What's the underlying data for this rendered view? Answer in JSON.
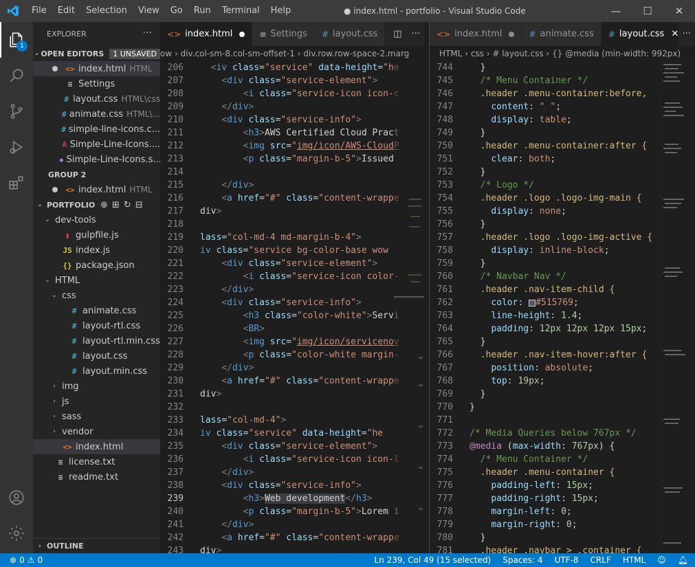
{
  "titlebar": {
    "menu": [
      "File",
      "Edit",
      "Selection",
      "View",
      "Go",
      "Run",
      "Terminal",
      "Help"
    ],
    "title": "● index.html - portfolio - Visual Studio Code",
    "controls": [
      "minimize-icon",
      "maximize-icon",
      "close-icon"
    ]
  },
  "activitybar": {
    "items": [
      {
        "name": "explorer-icon",
        "badge": "1"
      },
      {
        "name": "search-icon"
      },
      {
        "name": "source-control-icon"
      },
      {
        "name": "run-debug-icon"
      },
      {
        "name": "extensions-icon"
      }
    ],
    "bottom": [
      "account-icon",
      "settings-gear-icon"
    ]
  },
  "explorer": {
    "title": "EXPLORER",
    "more": "···",
    "open_editors": {
      "label": "OPEN EDITORS",
      "badge": "1 UNSAVED",
      "items": [
        {
          "icon": "<>",
          "color": "#e37933",
          "name": "index.html",
          "hint": "HTML",
          "dot": true,
          "selected": true
        },
        {
          "icon": "≡",
          "color": "#c5c5c5",
          "name": "Settings",
          "hint": ""
        },
        {
          "icon": "#",
          "color": "#519aba",
          "name": "layout.css",
          "hint": "HTML\\css"
        },
        {
          "icon": "#",
          "color": "#519aba",
          "name": "animate.css",
          "hint": "HTML\\..."
        },
        {
          "icon": "#",
          "color": "#519aba",
          "name": "simple-line-icons.c...",
          "hint": ""
        },
        {
          "icon": "A",
          "color": "#cc3e44",
          "name": "Simple-Line-Icons....",
          "hint": ""
        },
        {
          "icon": "◆",
          "color": "#a074c4",
          "name": "Simple-Line-Icons.s...",
          "hint": ""
        }
      ]
    },
    "group2": {
      "label": "GROUP 2",
      "items": [
        {
          "icon": "<>",
          "color": "#e37933",
          "name": "index.html",
          "hint": "HTML",
          "dot": true
        }
      ]
    },
    "portfolio": {
      "label": "PORTFOLIO",
      "tree": [
        {
          "depth": 1,
          "twisty": "⌄",
          "icon": "",
          "name": "dev-tools"
        },
        {
          "depth": 2,
          "twisty": "",
          "icon": "▮",
          "color": "#cc3e44",
          "name": "gulpfile.js"
        },
        {
          "depth": 2,
          "twisty": "",
          "icon": "JS",
          "color": "#cbcb41",
          "name": "index.js"
        },
        {
          "depth": 2,
          "twisty": "",
          "icon": "{}",
          "color": "#cbcb41",
          "name": "package.json"
        },
        {
          "depth": 1,
          "twisty": "⌄",
          "icon": "",
          "name": "HTML"
        },
        {
          "depth": 2,
          "twisty": "⌄",
          "icon": "",
          "name": "css"
        },
        {
          "depth": 3,
          "twisty": "",
          "icon": "#",
          "color": "#519aba",
          "name": "animate.css"
        },
        {
          "depth": 3,
          "twisty": "",
          "icon": "#",
          "color": "#519aba",
          "name": "layout-rtl.css"
        },
        {
          "depth": 3,
          "twisty": "",
          "icon": "#",
          "color": "#519aba",
          "name": "layout-rtl.min.css"
        },
        {
          "depth": 3,
          "twisty": "",
          "icon": "#",
          "color": "#519aba",
          "name": "layout.css"
        },
        {
          "depth": 3,
          "twisty": "",
          "icon": "#",
          "color": "#519aba",
          "name": "layout.min.css"
        },
        {
          "depth": 2,
          "twisty": "›",
          "icon": "",
          "name": "img"
        },
        {
          "depth": 2,
          "twisty": "›",
          "icon": "",
          "name": "js"
        },
        {
          "depth": 2,
          "twisty": "›",
          "icon": "",
          "name": "sass"
        },
        {
          "depth": 2,
          "twisty": "›",
          "icon": "",
          "name": "vendor"
        },
        {
          "depth": 2,
          "twisty": "",
          "icon": "<>",
          "color": "#e37933",
          "name": "index.html",
          "selected": true
        },
        {
          "depth": 1,
          "twisty": "",
          "icon": "≡",
          "color": "#c5c5c5",
          "name": "license.txt"
        },
        {
          "depth": 1,
          "twisty": "",
          "icon": "≡",
          "color": "#c5c5c5",
          "name": "readme.txt"
        }
      ]
    },
    "outline": "OUTLINE"
  },
  "editor1": {
    "tabs": [
      {
        "icon": "<>",
        "color": "#e37933",
        "label": "index.html",
        "modified": true,
        "active": true
      },
      {
        "icon": "≡",
        "color": "#c5c5c5",
        "label": "Settings"
      },
      {
        "icon": "#",
        "color": "#519aba",
        "label": "layout.css"
      }
    ],
    "breadcrumb": "ow  ›  div.col-sm-8.col-sm-offset-1  ›  div.row.row-space-2.marg"
  },
  "editor2": {
    "tabs": [
      {
        "icon": "<>",
        "color": "#e37933",
        "label": "index.html",
        "modified": true
      },
      {
        "icon": "#",
        "color": "#519aba",
        "label": "animate.css"
      },
      {
        "icon": "#",
        "color": "#519aba",
        "label": "layout.css",
        "active": true,
        "close": true
      }
    ],
    "breadcrumb": "HTML  ›  css  ›  # layout.css  ›  {} @media (min-width: 992px)"
  },
  "statusbar": {
    "errors": "0",
    "warnings": "0",
    "position": "Ln 239, Col 49 (15 selected)",
    "spaces": "Spaces: 4",
    "encoding": "UTF-8",
    "eol": "CRLF",
    "language": "HTML"
  }
}
